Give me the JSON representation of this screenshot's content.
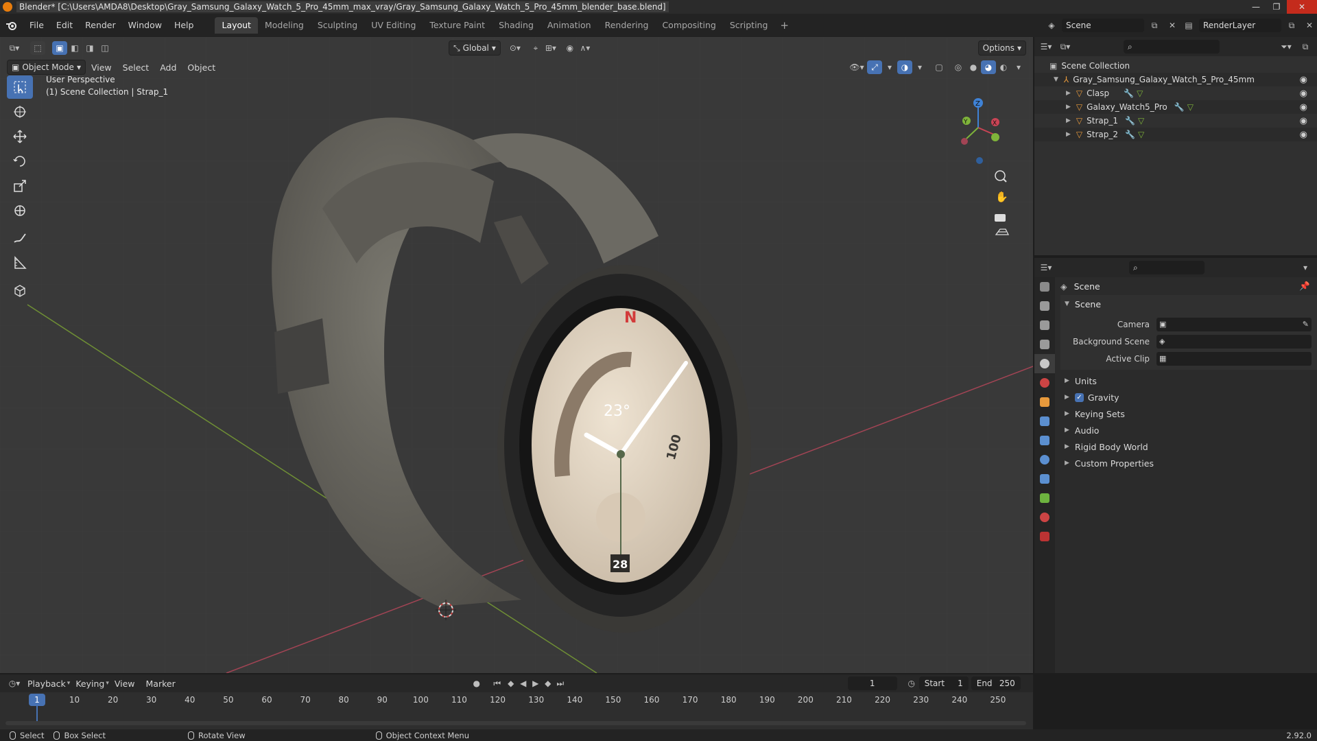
{
  "window": {
    "title": "Blender* [C:\\Users\\AMDA8\\Desktop\\Gray_Samsung_Galaxy_Watch_5_Pro_45mm_max_vray/Gray_Samsung_Galaxy_Watch_5_Pro_45mm_blender_base.blend]",
    "minimize": "—",
    "maximize": "❐",
    "close": "✕"
  },
  "menu": [
    "File",
    "Edit",
    "Render",
    "Window",
    "Help"
  ],
  "workspaces": [
    "Layout",
    "Modeling",
    "Sculpting",
    "UV Editing",
    "Texture Paint",
    "Shading",
    "Animation",
    "Rendering",
    "Compositing",
    "Scripting"
  ],
  "workspace_add": "+",
  "scene_name": "Scene",
  "render_layer": "RenderLayer",
  "viewport": {
    "mode": "Object Mode",
    "menus": [
      "View",
      "Select",
      "Add",
      "Object"
    ],
    "orientation": "Global",
    "options": "Options",
    "overlay_line1": "User Perspective",
    "overlay_line2": "(1) Scene Collection | Strap_1",
    "gizmo_labels": {
      "z": "Z",
      "y": "Y",
      "x": "X"
    },
    "watch_face": {
      "north": "N",
      "temperature": "23°",
      "distance": "100",
      "day": "28"
    }
  },
  "outliner": {
    "root": "Scene Collection",
    "collection": "Gray_Samsung_Galaxy_Watch_5_Pro_45mm",
    "objects": [
      "Clasp",
      "Galaxy_Watch5_Pro",
      "Strap_1",
      "Strap_2"
    ]
  },
  "properties": {
    "header": "Scene",
    "panel": "Scene",
    "rows": [
      {
        "label": "Camera"
      },
      {
        "label": "Background Scene"
      },
      {
        "label": "Active Clip"
      }
    ],
    "subpanels": [
      "Units",
      "Gravity",
      "Keying Sets",
      "Audio",
      "Rigid Body World",
      "Custom Properties"
    ],
    "gravity_checked": true
  },
  "timeline": {
    "menus": [
      "Playback",
      "Keying",
      "View",
      "Marker"
    ],
    "current_frame": "1",
    "start_label": "Start",
    "start": "1",
    "end_label": "End",
    "end": "250",
    "ticks": [
      "1",
      "10",
      "20",
      "30",
      "40",
      "50",
      "60",
      "70",
      "80",
      "90",
      "100",
      "110",
      "120",
      "130",
      "140",
      "150",
      "160",
      "170",
      "180",
      "190",
      "200",
      "210",
      "220",
      "230",
      "240",
      "250"
    ]
  },
  "statusbar": {
    "select": "Select",
    "box_select": "Box Select",
    "rotate_view": "Rotate View",
    "context_menu": "Object Context Menu",
    "version": "2.92.0"
  },
  "colors": {
    "accent": "#4772b3",
    "x_axis": "#c94455",
    "y_axis": "#7fb43a",
    "z_axis": "#3f82d6",
    "active_tab": "#3d3d3d"
  }
}
